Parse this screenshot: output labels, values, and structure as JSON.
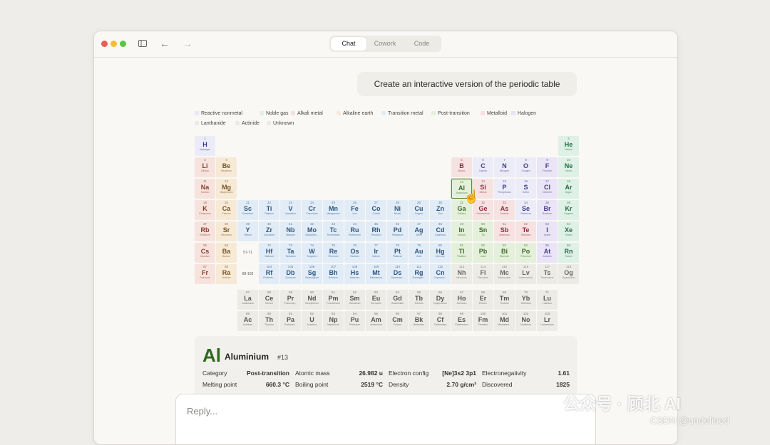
{
  "tabs": {
    "chat": "Chat",
    "cowork": "Cowork",
    "code": "Code"
  },
  "prompt": "Create an interactive version of the periodic table",
  "legend": [
    {
      "label": "Reactive nonmetal",
      "color": "#e7e7f8"
    },
    {
      "label": "Noble gas",
      "color": "#dff0e6"
    },
    {
      "label": "Alkali metal",
      "color": "#f6e2dc"
    },
    {
      "label": "Alkaline earth",
      "color": "#f6ebd8"
    },
    {
      "label": "Transition metal",
      "color": "#e2ecf6"
    },
    {
      "label": "Post-transition",
      "color": "#e3f0da"
    },
    {
      "label": "Metalloid",
      "color": "#f6e0e0"
    },
    {
      "label": "Halogen",
      "color": "#e8e3f5"
    },
    {
      "label": "Lanthanide",
      "color": "#ecebe7"
    },
    {
      "label": "Actinide",
      "color": "#ecebe7"
    },
    {
      "label": "Unknown",
      "color": "#ecebe7"
    }
  ],
  "colors": {
    "nonmetal": {
      "bg": "#ececf8",
      "fg": "#3a3a8a"
    },
    "noble": {
      "bg": "#dff0e6",
      "fg": "#1f6b45"
    },
    "alkali": {
      "bg": "#f7e3dd",
      "fg": "#8a3a2a"
    },
    "alkaline": {
      "bg": "#f6ead6",
      "fg": "#7a5320"
    },
    "transition": {
      "bg": "#e2ecf7",
      "fg": "#2a5580"
    },
    "post": {
      "bg": "#e4f0db",
      "fg": "#3c6a25"
    },
    "metalloid": {
      "bg": "#f7e2e2",
      "fg": "#8a2e3a"
    },
    "halogen": {
      "bg": "#e9e4f6",
      "fg": "#4a3a8a"
    },
    "lanthanide": {
      "bg": "#ecebe6",
      "fg": "#555555"
    },
    "actinide": {
      "bg": "#ecebe6",
      "fg": "#555555"
    },
    "unknown": {
      "bg": "#ecebe6",
      "fg": "#666666"
    }
  },
  "elements": [
    {
      "n": 1,
      "s": "H",
      "nm": "Hydrogen",
      "c": "nonmetal",
      "col": 1,
      "row": 1
    },
    {
      "n": 2,
      "s": "He",
      "nm": "Helium",
      "c": "noble",
      "col": 18,
      "row": 1
    },
    {
      "n": 3,
      "s": "Li",
      "nm": "Lithium",
      "c": "alkali",
      "col": 1,
      "row": 2
    },
    {
      "n": 4,
      "s": "Be",
      "nm": "Beryllium",
      "c": "alkaline",
      "col": 2,
      "row": 2
    },
    {
      "n": 5,
      "s": "B",
      "nm": "Boron",
      "c": "metalloid",
      "col": 13,
      "row": 2
    },
    {
      "n": 6,
      "s": "C",
      "nm": "Carbon",
      "c": "nonmetal",
      "col": 14,
      "row": 2
    },
    {
      "n": 7,
      "s": "N",
      "nm": "Nitrogen",
      "c": "nonmetal",
      "col": 15,
      "row": 2
    },
    {
      "n": 8,
      "s": "O",
      "nm": "Oxygen",
      "c": "nonmetal",
      "col": 16,
      "row": 2
    },
    {
      "n": 9,
      "s": "F",
      "nm": "Fluorine",
      "c": "halogen",
      "col": 17,
      "row": 2
    },
    {
      "n": 10,
      "s": "Ne",
      "nm": "Neon",
      "c": "noble",
      "col": 18,
      "row": 2
    },
    {
      "n": 11,
      "s": "Na",
      "nm": "Sodium",
      "c": "alkali",
      "col": 1,
      "row": 3
    },
    {
      "n": 12,
      "s": "Mg",
      "nm": "Magnesium",
      "c": "alkaline",
      "col": 2,
      "row": 3
    },
    {
      "n": 13,
      "s": "Al",
      "nm": "Aluminium",
      "c": "post",
      "col": 13,
      "row": 3,
      "sel": true
    },
    {
      "n": 14,
      "s": "Si",
      "nm": "Silicon",
      "c": "metalloid",
      "col": 14,
      "row": 3
    },
    {
      "n": 15,
      "s": "P",
      "nm": "Phosphorus",
      "c": "nonmetal",
      "col": 15,
      "row": 3
    },
    {
      "n": 16,
      "s": "S",
      "nm": "Sulfur",
      "c": "nonmetal",
      "col": 16,
      "row": 3
    },
    {
      "n": 17,
      "s": "Cl",
      "nm": "Chlorine",
      "c": "halogen",
      "col": 17,
      "row": 3
    },
    {
      "n": 18,
      "s": "Ar",
      "nm": "Argon",
      "c": "noble",
      "col": 18,
      "row": 3
    },
    {
      "n": 19,
      "s": "K",
      "nm": "Potassium",
      "c": "alkali",
      "col": 1,
      "row": 4
    },
    {
      "n": 20,
      "s": "Ca",
      "nm": "Calcium",
      "c": "alkaline",
      "col": 2,
      "row": 4
    },
    {
      "n": 21,
      "s": "Sc",
      "nm": "Scandium",
      "c": "transition",
      "col": 3,
      "row": 4
    },
    {
      "n": 22,
      "s": "Ti",
      "nm": "Titanium",
      "c": "transition",
      "col": 4,
      "row": 4
    },
    {
      "n": 23,
      "s": "V",
      "nm": "Vanadium",
      "c": "transition",
      "col": 5,
      "row": 4
    },
    {
      "n": 24,
      "s": "Cr",
      "nm": "Chromium",
      "c": "transition",
      "col": 6,
      "row": 4
    },
    {
      "n": 25,
      "s": "Mn",
      "nm": "Manganese",
      "c": "transition",
      "col": 7,
      "row": 4
    },
    {
      "n": 26,
      "s": "Fe",
      "nm": "Iron",
      "c": "transition",
      "col": 8,
      "row": 4
    },
    {
      "n": 27,
      "s": "Co",
      "nm": "Cobalt",
      "c": "transition",
      "col": 9,
      "row": 4
    },
    {
      "n": 28,
      "s": "Ni",
      "nm": "Nickel",
      "c": "transition",
      "col": 10,
      "row": 4
    },
    {
      "n": 29,
      "s": "Cu",
      "nm": "Copper",
      "c": "transition",
      "col": 11,
      "row": 4
    },
    {
      "n": 30,
      "s": "Zn",
      "nm": "Zinc",
      "c": "transition",
      "col": 12,
      "row": 4
    },
    {
      "n": 31,
      "s": "Ga",
      "nm": "Gallium",
      "c": "post",
      "col": 13,
      "row": 4
    },
    {
      "n": 32,
      "s": "Ge",
      "nm": "Germanium",
      "c": "metalloid",
      "col": 14,
      "row": 4
    },
    {
      "n": 33,
      "s": "As",
      "nm": "Arsenic",
      "c": "metalloid",
      "col": 15,
      "row": 4
    },
    {
      "n": 34,
      "s": "Se",
      "nm": "Selenium",
      "c": "nonmetal",
      "col": 16,
      "row": 4
    },
    {
      "n": 35,
      "s": "Br",
      "nm": "Bromine",
      "c": "halogen",
      "col": 17,
      "row": 4
    },
    {
      "n": 36,
      "s": "Kr",
      "nm": "Krypton",
      "c": "noble",
      "col": 18,
      "row": 4
    },
    {
      "n": 37,
      "s": "Rb",
      "nm": "Rubidium",
      "c": "alkali",
      "col": 1,
      "row": 5
    },
    {
      "n": 38,
      "s": "Sr",
      "nm": "Strontium",
      "c": "alkaline",
      "col": 2,
      "row": 5
    },
    {
      "n": 39,
      "s": "Y",
      "nm": "Yttrium",
      "c": "transition",
      "col": 3,
      "row": 5
    },
    {
      "n": 40,
      "s": "Zr",
      "nm": "Zirconium",
      "c": "transition",
      "col": 4,
      "row": 5
    },
    {
      "n": 41,
      "s": "Nb",
      "nm": "Niobium",
      "c": "transition",
      "col": 5,
      "row": 5
    },
    {
      "n": 42,
      "s": "Mo",
      "nm": "Molybden...",
      "c": "transition",
      "col": 6,
      "row": 5
    },
    {
      "n": 43,
      "s": "Tc",
      "nm": "Technetium",
      "c": "transition",
      "col": 7,
      "row": 5
    },
    {
      "n": 44,
      "s": "Ru",
      "nm": "Ruthenium",
      "c": "transition",
      "col": 8,
      "row": 5
    },
    {
      "n": 45,
      "s": "Rh",
      "nm": "Rhodium",
      "c": "transition",
      "col": 9,
      "row": 5
    },
    {
      "n": 46,
      "s": "Pd",
      "nm": "Palladium",
      "c": "transition",
      "col": 10,
      "row": 5
    },
    {
      "n": 47,
      "s": "Ag",
      "nm": "Silver",
      "c": "transition",
      "col": 11,
      "row": 5
    },
    {
      "n": 48,
      "s": "Cd",
      "nm": "Cadmium",
      "c": "transition",
      "col": 12,
      "row": 5
    },
    {
      "n": 49,
      "s": "In",
      "nm": "Indium",
      "c": "post",
      "col": 13,
      "row": 5
    },
    {
      "n": 50,
      "s": "Sn",
      "nm": "Tin",
      "c": "post",
      "col": 14,
      "row": 5
    },
    {
      "n": 51,
      "s": "Sb",
      "nm": "Antimony",
      "c": "metalloid",
      "col": 15,
      "row": 5
    },
    {
      "n": 52,
      "s": "Te",
      "nm": "Tellurium",
      "c": "metalloid",
      "col": 16,
      "row": 5
    },
    {
      "n": 53,
      "s": "I",
      "nm": "Iodine",
      "c": "halogen",
      "col": 17,
      "row": 5
    },
    {
      "n": 54,
      "s": "Xe",
      "nm": "Xenon",
      "c": "noble",
      "col": 18,
      "row": 5
    },
    {
      "n": 55,
      "s": "Cs",
      "nm": "Caesium",
      "c": "alkali",
      "col": 1,
      "row": 6
    },
    {
      "n": 56,
      "s": "Ba",
      "nm": "Barium",
      "c": "alkaline",
      "col": 2,
      "row": 6
    },
    {
      "n": 72,
      "s": "Hf",
      "nm": "Hafnium",
      "c": "transition",
      "col": 4,
      "row": 6
    },
    {
      "n": 73,
      "s": "Ta",
      "nm": "Tantalum",
      "c": "transition",
      "col": 5,
      "row": 6
    },
    {
      "n": 74,
      "s": "W",
      "nm": "Tungsten",
      "c": "transition",
      "col": 6,
      "row": 6
    },
    {
      "n": 75,
      "s": "Re",
      "nm": "Rhenium",
      "c": "transition",
      "col": 7,
      "row": 6
    },
    {
      "n": 76,
      "s": "Os",
      "nm": "Osmium",
      "c": "transition",
      "col": 8,
      "row": 6
    },
    {
      "n": 77,
      "s": "Ir",
      "nm": "Iridium",
      "c": "transition",
      "col": 9,
      "row": 6
    },
    {
      "n": 78,
      "s": "Pt",
      "nm": "Platinum",
      "c": "transition",
      "col": 10,
      "row": 6
    },
    {
      "n": 79,
      "s": "Au",
      "nm": "Gold",
      "c": "transition",
      "col": 11,
      "row": 6
    },
    {
      "n": 80,
      "s": "Hg",
      "nm": "Mercury",
      "c": "transition",
      "col": 12,
      "row": 6
    },
    {
      "n": 81,
      "s": "Tl",
      "nm": "Thallium",
      "c": "post",
      "col": 13,
      "row": 6
    },
    {
      "n": 82,
      "s": "Pb",
      "nm": "Lead",
      "c": "post",
      "col": 14,
      "row": 6
    },
    {
      "n": 83,
      "s": "Bi",
      "nm": "Bismuth",
      "c": "post",
      "col": 15,
      "row": 6
    },
    {
      "n": 84,
      "s": "Po",
      "nm": "Polonium",
      "c": "post",
      "col": 16,
      "row": 6
    },
    {
      "n": 85,
      "s": "At",
      "nm": "Astatine",
      "c": "halogen",
      "col": 17,
      "row": 6
    },
    {
      "n": 86,
      "s": "Rn",
      "nm": "Radon",
      "c": "noble",
      "col": 18,
      "row": 6
    },
    {
      "n": 87,
      "s": "Fr",
      "nm": "Francium",
      "c": "alkali",
      "col": 1,
      "row": 7
    },
    {
      "n": 88,
      "s": "Ra",
      "nm": "Radium",
      "c": "alkaline",
      "col": 2,
      "row": 7
    },
    {
      "n": 104,
      "s": "Rf",
      "nm": "Rutherfo...",
      "c": "transition",
      "col": 4,
      "row": 7
    },
    {
      "n": 105,
      "s": "Db",
      "nm": "Dubnium",
      "c": "transition",
      "col": 5,
      "row": 7
    },
    {
      "n": 106,
      "s": "Sg",
      "nm": "Seaborgium",
      "c": "transition",
      "col": 6,
      "row": 7
    },
    {
      "n": 107,
      "s": "Bh",
      "nm": "Bohrium",
      "c": "transition",
      "col": 7,
      "row": 7
    },
    {
      "n": 108,
      "s": "Hs",
      "nm": "Hassium",
      "c": "transition",
      "col": 8,
      "row": 7
    },
    {
      "n": 109,
      "s": "Mt",
      "nm": "Meitnerium",
      "c": "transition",
      "col": 9,
      "row": 7
    },
    {
      "n": 110,
      "s": "Ds",
      "nm": "Darmstad...",
      "c": "transition",
      "col": 10,
      "row": 7
    },
    {
      "n": 111,
      "s": "Rg",
      "nm": "Roentgen...",
      "c": "transition",
      "col": 11,
      "row": 7
    },
    {
      "n": 112,
      "s": "Cn",
      "nm": "Copernici...",
      "c": "transition",
      "col": 12,
      "row": 7
    },
    {
      "n": 113,
      "s": "Nh",
      "nm": "Nihonium",
      "c": "unknown",
      "col": 13,
      "row": 7
    },
    {
      "n": 114,
      "s": "Fl",
      "nm": "Flerovium",
      "c": "unknown",
      "col": 14,
      "row": 7
    },
    {
      "n": 115,
      "s": "Mc",
      "nm": "Moscovium",
      "c": "unknown",
      "col": 15,
      "row": 7
    },
    {
      "n": 116,
      "s": "Lv",
      "nm": "Livermorium",
      "c": "unknown",
      "col": 16,
      "row": 7
    },
    {
      "n": 117,
      "s": "Ts",
      "nm": "Tennessine",
      "c": "unknown",
      "col": 17,
      "row": 7
    },
    {
      "n": 118,
      "s": "Og",
      "nm": "Oganesson",
      "c": "unknown",
      "col": 18,
      "row": 7
    },
    {
      "n": 57,
      "s": "La",
      "nm": "Lanthanum",
      "c": "lanthanide",
      "col": 3,
      "row": 8
    },
    {
      "n": 58,
      "s": "Ce",
      "nm": "Cerium",
      "c": "lanthanide",
      "col": 4,
      "row": 8
    },
    {
      "n": 59,
      "s": "Pr",
      "nm": "Praseody...",
      "c": "lanthanide",
      "col": 5,
      "row": 8
    },
    {
      "n": 60,
      "s": "Nd",
      "nm": "Neodymium",
      "c": "lanthanide",
      "col": 6,
      "row": 8
    },
    {
      "n": 61,
      "s": "Pm",
      "nm": "Promethium",
      "c": "lanthanide",
      "col": 7,
      "row": 8
    },
    {
      "n": 62,
      "s": "Sm",
      "nm": "Samarium",
      "c": "lanthanide",
      "col": 8,
      "row": 8
    },
    {
      "n": 63,
      "s": "Eu",
      "nm": "Europium",
      "c": "lanthanide",
      "col": 9,
      "row": 8
    },
    {
      "n": 64,
      "s": "Gd",
      "nm": "Gadolinium",
      "c": "lanthanide",
      "col": 10,
      "row": 8
    },
    {
      "n": 65,
      "s": "Tb",
      "nm": "Terbium",
      "c": "lanthanide",
      "col": 11,
      "row": 8
    },
    {
      "n": 66,
      "s": "Dy",
      "nm": "Dysprosium",
      "c": "lanthanide",
      "col": 12,
      "row": 8
    },
    {
      "n": 67,
      "s": "Ho",
      "nm": "Holmium",
      "c": "lanthanide",
      "col": 13,
      "row": 8
    },
    {
      "n": 68,
      "s": "Er",
      "nm": "Erbium",
      "c": "lanthanide",
      "col": 14,
      "row": 8
    },
    {
      "n": 69,
      "s": "Tm",
      "nm": "Thulium",
      "c": "lanthanide",
      "col": 15,
      "row": 8
    },
    {
      "n": 70,
      "s": "Yb",
      "nm": "Ytterbium",
      "c": "lanthanide",
      "col": 16,
      "row": 8
    },
    {
      "n": 71,
      "s": "Lu",
      "nm": "Lutetium",
      "c": "lanthanide",
      "col": 17,
      "row": 8
    },
    {
      "n": 89,
      "s": "Ac",
      "nm": "Actinium",
      "c": "actinide",
      "col": 3,
      "row": 9
    },
    {
      "n": 90,
      "s": "Th",
      "nm": "Thorium",
      "c": "actinide",
      "col": 4,
      "row": 9
    },
    {
      "n": 91,
      "s": "Pa",
      "nm": "Protactini...",
      "c": "actinide",
      "col": 5,
      "row": 9
    },
    {
      "n": 92,
      "s": "U",
      "nm": "Uranium",
      "c": "actinide",
      "col": 6,
      "row": 9
    },
    {
      "n": 93,
      "s": "Np",
      "nm": "Neptunium",
      "c": "actinide",
      "col": 7,
      "row": 9
    },
    {
      "n": 94,
      "s": "Pu",
      "nm": "Plutonium",
      "c": "actinide",
      "col": 8,
      "row": 9
    },
    {
      "n": 95,
      "s": "Am",
      "nm": "Americium",
      "c": "actinide",
      "col": 9,
      "row": 9
    },
    {
      "n": 96,
      "s": "Cm",
      "nm": "Curium",
      "c": "actinide",
      "col": 10,
      "row": 9
    },
    {
      "n": 97,
      "s": "Bk",
      "nm": "Berkelium",
      "c": "actinide",
      "col": 11,
      "row": 9
    },
    {
      "n": 98,
      "s": "Cf",
      "nm": "Californium",
      "c": "actinide",
      "col": 12,
      "row": 9
    },
    {
      "n": 99,
      "s": "Es",
      "nm": "Einsteinium",
      "c": "actinide",
      "col": 13,
      "row": 9
    },
    {
      "n": 100,
      "s": "Fm",
      "nm": "Fermium",
      "c": "actinide",
      "col": 14,
      "row": 9
    },
    {
      "n": 101,
      "s": "Md",
      "nm": "Mendelevi...",
      "c": "actinide",
      "col": 15,
      "row": 9
    },
    {
      "n": 102,
      "s": "No",
      "nm": "Nobelium",
      "c": "actinide",
      "col": 16,
      "row": 9
    },
    {
      "n": 103,
      "s": "Lr",
      "nm": "Lawrencium",
      "c": "actinide",
      "col": 17,
      "row": 9
    }
  ],
  "placeholders": [
    {
      "label": "57-71",
      "col": 3,
      "row": 6
    },
    {
      "label": "89-103",
      "col": 3,
      "row": 7
    }
  ],
  "detail": {
    "symbol": "Al",
    "name": "Aluminium",
    "number": "#13",
    "rows": [
      [
        {
          "k": "Category",
          "v": "Post-transition"
        },
        {
          "k": "Atomic mass",
          "v": "26.982 u"
        },
        {
          "k": "Electron config",
          "v": "[Ne]3s2 3p1"
        },
        {
          "k": "Electronegativity",
          "v": "1.61"
        }
      ],
      [
        {
          "k": "Melting point",
          "v": "660.3 °C"
        },
        {
          "k": "Boiling point",
          "v": "2519 °C"
        },
        {
          "k": "Density",
          "v": "2.70 g/cm³"
        },
        {
          "k": "Discovered",
          "v": "1825"
        }
      ]
    ]
  },
  "reply_placeholder": "Reply...",
  "watermark": {
    "main": "公众号 · 顾北 AI",
    "sub": "CSDN @undefined"
  }
}
